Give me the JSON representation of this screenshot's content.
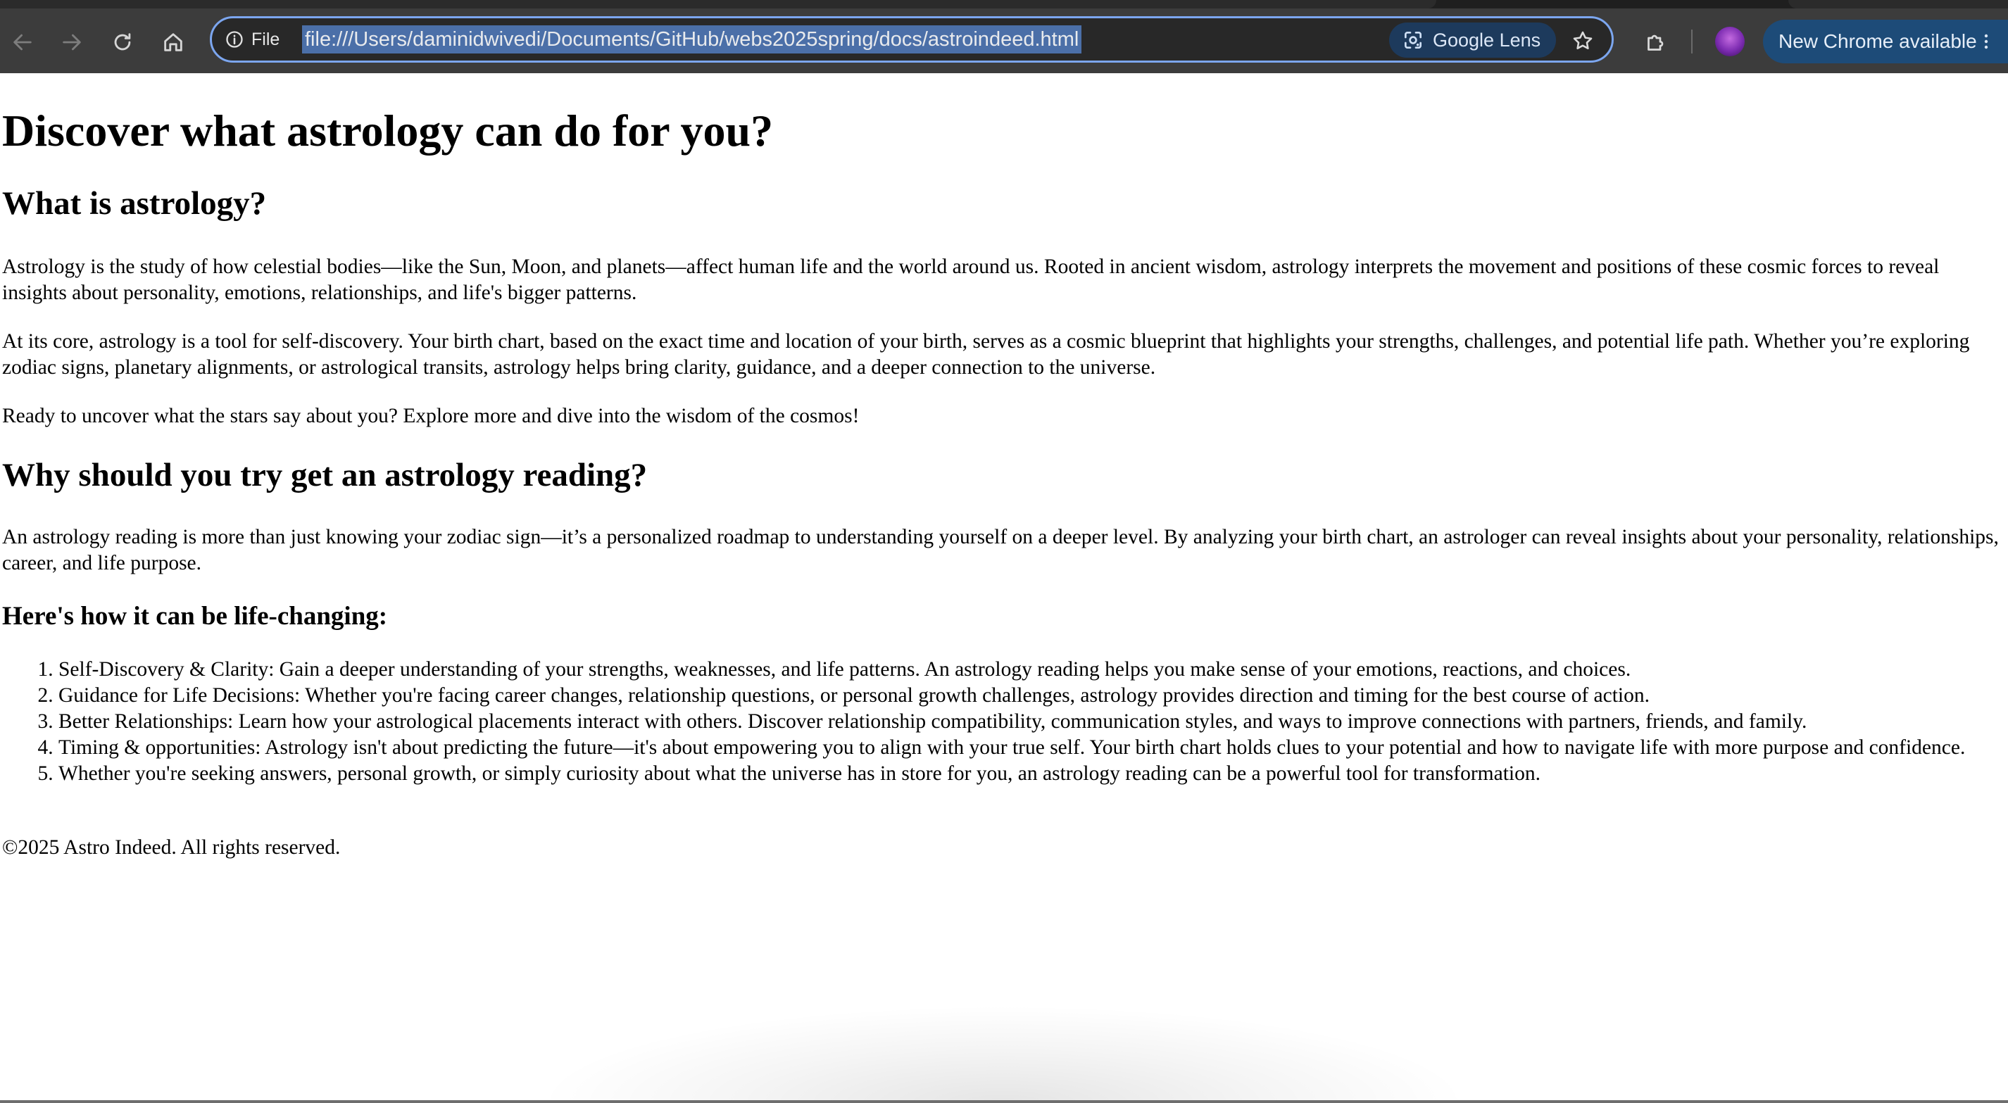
{
  "browser": {
    "site_info_label": "File",
    "url": "file:///Users/daminidwivedi/Documents/GitHub/webs2025spring/docs/astroindeed.html",
    "lens_label": "Google Lens",
    "update_label": "New Chrome available",
    "icons": {
      "back": "back-arrow-icon",
      "forward": "forward-arrow-icon",
      "reload": "reload-icon",
      "home": "home-icon",
      "info": "info-icon",
      "lens": "google-lens-icon",
      "bookmark": "star-icon",
      "extensions": "puzzle-icon",
      "menu": "kebab-menu-icon"
    },
    "colors": {
      "toolbar": "#3c3c3c",
      "omnibox_border": "#7ca6ef",
      "url_highlight": "#4b6fa8",
      "update_button": "#1d4b78"
    }
  },
  "page": {
    "title": "Discover what astrology can do for you?",
    "section1": {
      "heading": "What is astrology?",
      "paragraphs": [
        "Astrology is the study of how celestial bodies—like the Sun, Moon, and planets—affect human life and the world around us. Rooted in ancient wisdom, astrology interprets the movement and positions of these cosmic forces to reveal insights about personality, emotions, relationships, and life's bigger patterns.",
        "At its core, astrology is a tool for self-discovery. Your birth chart, based on the exact time and location of your birth, serves as a cosmic blueprint that highlights your strengths, challenges, and potential life path. Whether you’re exploring zodiac signs, planetary alignments, or astrological transits, astrology helps bring clarity, guidance, and a deeper connection to the universe.",
        "Ready to uncover what the stars say about you? Explore more and dive into the wisdom of the cosmos!"
      ]
    },
    "section2": {
      "heading": "Why should you try get an astrology reading?",
      "paragraph": "An astrology reading is more than just knowing your zodiac sign—it’s a personalized roadmap to understanding yourself on a deeper level. By analyzing your birth chart, an astrologer can reveal insights about your personality, relationships, career, and life purpose.",
      "subheading": "Here's how it can be life-changing:",
      "list": [
        "Self-Discovery & Clarity: Gain a deeper understanding of your strengths, weaknesses, and life patterns. An astrology reading helps you make sense of your emotions, reactions, and choices.",
        "Guidance for Life Decisions: Whether you're facing career changes, relationship questions, or personal growth challenges, astrology provides direction and timing for the best course of action.",
        "Better Relationships: Learn how your astrological placements interact with others. Discover relationship compatibility, communication styles, and ways to improve connections with partners, friends, and family.",
        "Timing & opportunities: Astrology isn't about predicting the future—it's about empowering you to align with your true self. Your birth chart holds clues to your potential and how to navigate life with more purpose and confidence.",
        "Whether you're seeking answers, personal growth, or simply curiosity about what the universe has in store for you, an astrology reading can be a powerful tool for transformation."
      ]
    },
    "footer": "©2025 Astro Indeed. All rights reserved."
  }
}
